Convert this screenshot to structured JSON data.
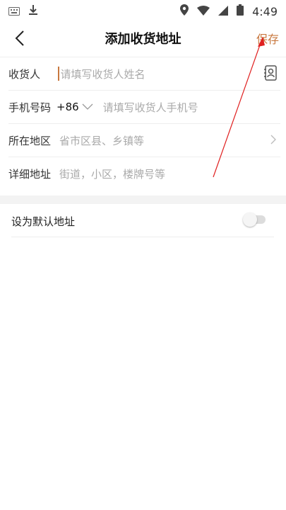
{
  "status_bar": {
    "time": "4:49",
    "left_icons": [
      "keyboard-icon",
      "download-icon"
    ],
    "right_icons": [
      "location-icon",
      "wifi-icon",
      "signal-icon",
      "battery-icon"
    ]
  },
  "nav": {
    "title": "添加收货地址",
    "save_label": "保存",
    "accent_color": "#c8783f"
  },
  "form": {
    "receiver": {
      "label": "收货人",
      "placeholder": "请填写收货人姓名"
    },
    "phone": {
      "label": "手机号码",
      "country_code": "+86",
      "placeholder": "请填写收货人手机号"
    },
    "region": {
      "label": "所在地区",
      "placeholder": "省市区县、乡镇等"
    },
    "address": {
      "label": "详细地址",
      "placeholder": "街道，小区，楼牌号等"
    }
  },
  "default_address": {
    "label": "设为默认地址",
    "enabled": false
  }
}
